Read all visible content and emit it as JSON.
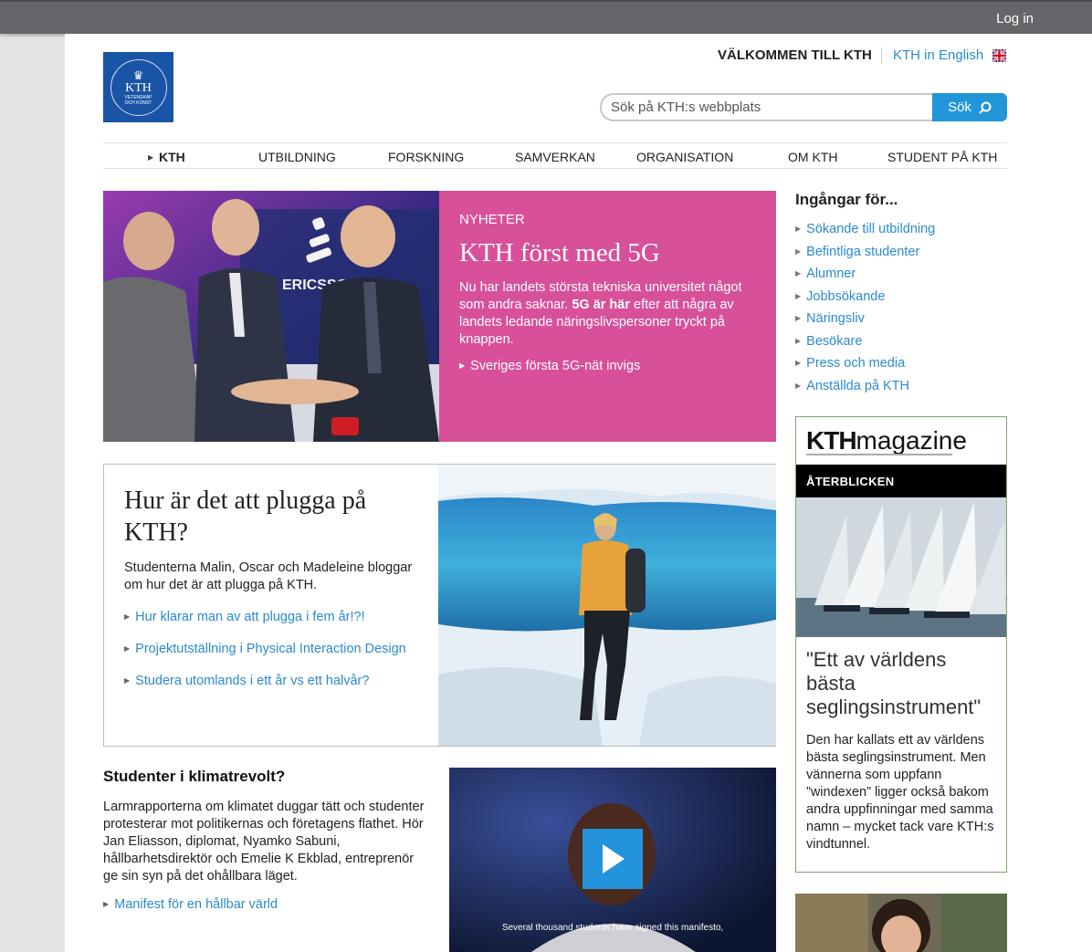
{
  "topbar": {
    "login": "Log in"
  },
  "header": {
    "logo_kth": "KTH",
    "logo_sub_1": "VETENSKAP",
    "logo_sub_2": "OCH KONST",
    "welcome": "VÄLKOMMEN TILL KTH",
    "english": "KTH in English"
  },
  "search": {
    "placeholder": "Sök på KTH:s webbplats",
    "button": "Sök"
  },
  "nav": [
    "KTH",
    "UTBILDNING",
    "FORSKNING",
    "SAMVERKAN",
    "ORGANISATION",
    "OM KTH",
    "STUDENT PÅ KTH"
  ],
  "hero": {
    "tag": "NYHETER",
    "title": "KTH först med 5G",
    "text_1": "Nu har landets största tekniska universitet något som andra saknar. ",
    "text_bold": "5G är här",
    "text_2": " efter att några av landets ledande näringslivspersoner tryckt på knappen.",
    "link": "Sveriges första 5G-nät invigs",
    "photo_text": "ERICSSON"
  },
  "study": {
    "title": "Hur är det att plugga på KTH?",
    "text": "Studenterna Malin, Oscar och Madeleine bloggar om hur det är att plugga på KTH.",
    "links": [
      "Hur klarar man av att plugga i fem år!?!",
      "Projektutställning i Physical Interaction Design",
      "Studera utomlands i ett år vs ett halvår?"
    ]
  },
  "climate": {
    "title": "Studenter i klimatrevolt?",
    "text": "Larmrapporterna om klimatet duggar tätt och studenter protesterar mot politikernas och företagens flathet. Hör Jan Eliasson, diplomat, Nyamko Sabuni, hållbarhetsdirektör och Emelie K Ekblad, entreprenör ge sin syn på det ohållbara läget.",
    "link": "Manifest för en hållbar värld",
    "video_caption": "Several thousand students have signed this manifesto,"
  },
  "entries": {
    "title": "Ingångar för...",
    "items": [
      "Sökande till utbildning",
      "Befintliga studenter",
      "Alumner",
      "Jobbsökande",
      "Näringsliv",
      "Besökare",
      "Press och media",
      "Anställda på KTH"
    ]
  },
  "magazine": {
    "brand_bold": "KTH",
    "brand_light": "magazine",
    "section": "ÅTERBLICKEN",
    "quote": "\"Ett av världens bästa seglingsinstrument\"",
    "text": "Den har kallats ett av världens bästa seglingsinstrument. Men vännerna som uppfann ”windexen” ligger också bakom andra uppfinningar med samma namn – mycket tack vare KTH:s vindtunnel."
  },
  "colors": {
    "accent": "#2196d8",
    "hero_bg": "#d8509a",
    "link": "#2a8ad0",
    "logo_bg": "#1954a6"
  },
  "icons": [
    "search-icon",
    "uk-flag-icon",
    "play-icon",
    "triangle-right-icon"
  ]
}
